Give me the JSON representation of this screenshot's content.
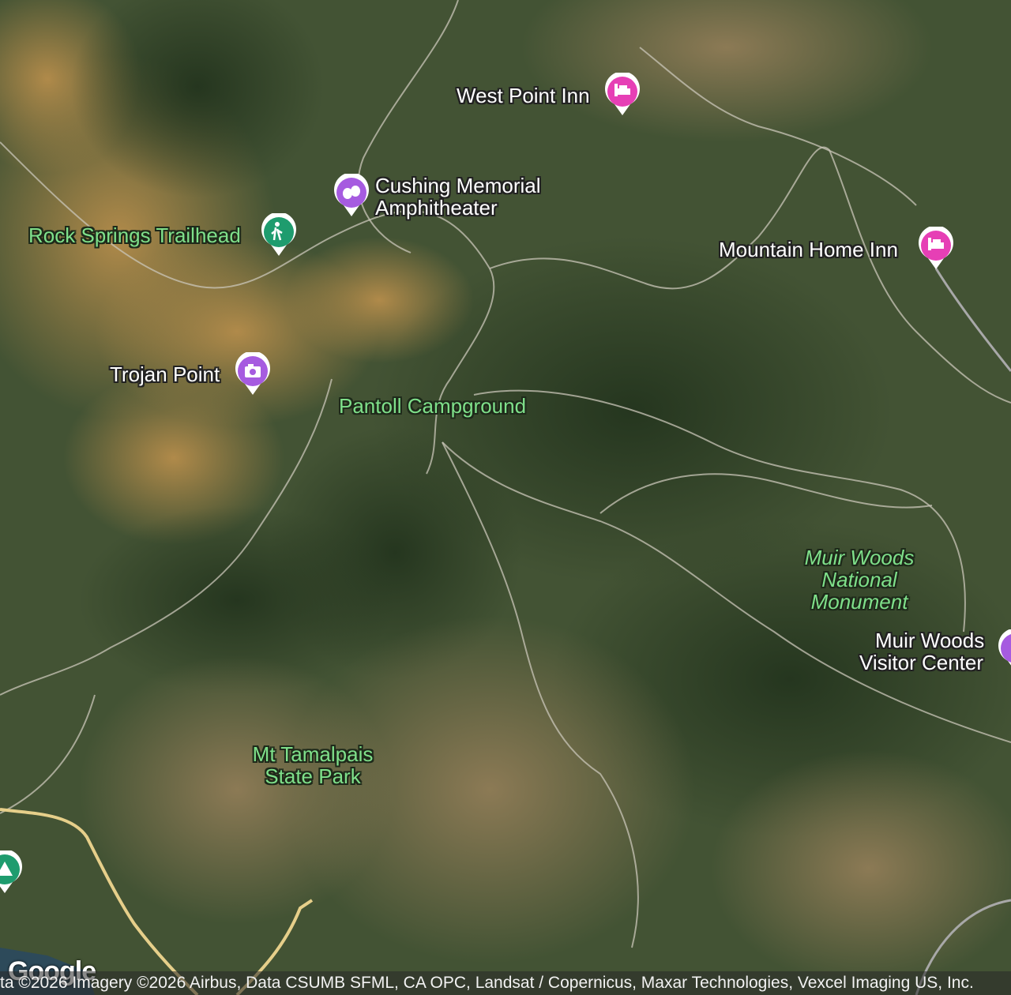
{
  "map": {
    "type": "satellite",
    "places": {
      "west_point_inn": "West Point Inn",
      "cushing_line1": "Cushing Memorial",
      "cushing_line2": "Amphitheater",
      "rock_springs": "Rock Springs Trailhead",
      "mountain_home_inn": "Mountain Home Inn",
      "trojan_point": "Trojan Point",
      "pantoll": "Pantoll Campground",
      "muir_woods_nm_1": "Muir Woods",
      "muir_woods_nm_2": "National",
      "muir_woods_nm_3": "Monument",
      "muir_woods_vc_1": "Muir Woods",
      "muir_woods_vc_2": "Visitor Center",
      "mt_tam_1": "Mt Tamalpais",
      "mt_tam_2": "State Park"
    },
    "colors": {
      "lodging": "#e63fb5",
      "attraction": "#a65be0",
      "trail": "#1e9c6e"
    },
    "logo": "Google",
    "attribution": "ta ©2026 Imagery ©2026 Airbus, Data CSUMB SFML, CA OPC, Landsat / Copernicus, Maxar Technologies, Vexcel Imaging US, Inc."
  }
}
